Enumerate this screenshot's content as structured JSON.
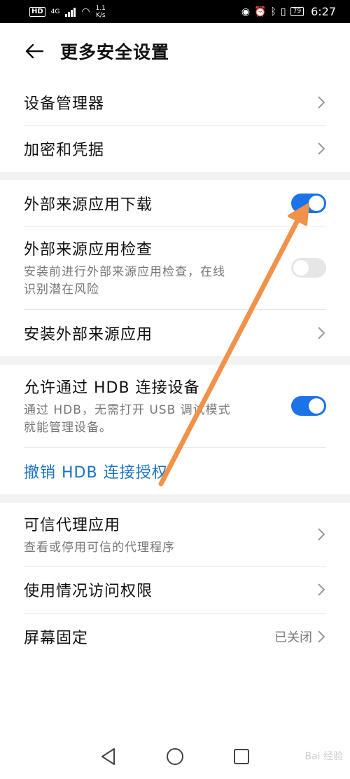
{
  "status_bar": {
    "hd": "HD",
    "network": "4G",
    "speed_value": "1.1",
    "speed_unit": "K/s",
    "battery": "79",
    "time": "6:27"
  },
  "header": {
    "title": "更多安全设置",
    "back_icon": "arrow-left-icon"
  },
  "sections": {
    "device_admin": {
      "title": "设备管理器"
    },
    "credentials": {
      "title": "加密和凭据"
    },
    "ext_download": {
      "title": "外部来源应用下载",
      "enabled": true
    },
    "ext_check": {
      "title": "外部来源应用检查",
      "subtitle_line1": "安装前进行外部来源应用检查，在线",
      "subtitle_line2": "识别潜在风险",
      "enabled": false
    },
    "install_ext": {
      "title": "安装外部来源应用"
    },
    "hdb": {
      "title": "允许通过 HDB 连接设备",
      "subtitle_line1": "通过 HDB，无需打开 USB 调试模式",
      "subtitle_line2": "就能管理设备。",
      "enabled": true
    },
    "revoke_hdb": {
      "title": "撤销 HDB 连接授权"
    },
    "trust_agents": {
      "title": "可信代理应用",
      "subtitle": "查看或停用可信的代理程序"
    },
    "usage_access": {
      "title": "使用情况访问权限"
    },
    "screen_pin": {
      "title": "屏幕固定",
      "value": "已关闭"
    }
  },
  "colors": {
    "accent": "#1a73e8",
    "link": "#1a73c8",
    "annotation_arrow": "#f0924a"
  },
  "watermark": "Bai 经验"
}
